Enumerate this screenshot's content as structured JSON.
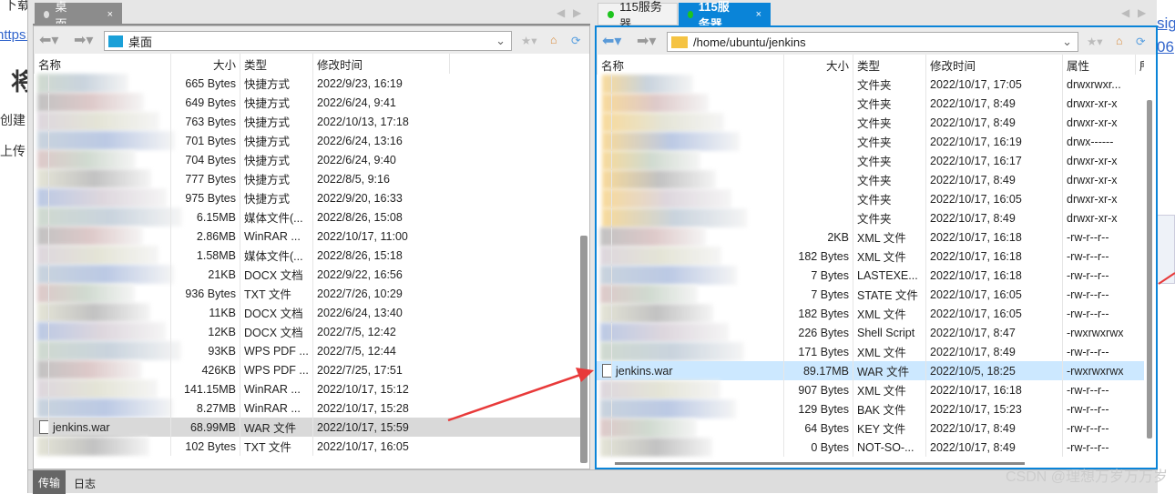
{
  "background": {
    "top_text": "下载",
    "link": "https://",
    "heading": "将",
    "line1": "创建",
    "line2": "上传",
    "right_link1": "sig",
    "right_link2": "06"
  },
  "left": {
    "tab": {
      "label": "桌面",
      "close": "×"
    },
    "path": "桌面",
    "columns": [
      "名称",
      "大小",
      "类型",
      "修改时间"
    ],
    "rows": [
      {
        "name": "",
        "size": "665 Bytes",
        "type": "快捷方式",
        "date": "2022/9/23, 16:19"
      },
      {
        "name": "",
        "size": "649 Bytes",
        "type": "快捷方式",
        "date": "2022/6/24, 9:41"
      },
      {
        "name": "",
        "size": "763 Bytes",
        "type": "快捷方式",
        "date": "2022/10/13, 17:18"
      },
      {
        "name": "",
        "size": "701 Bytes",
        "type": "快捷方式",
        "date": "2022/6/24, 13:16"
      },
      {
        "name": "",
        "size": "704 Bytes",
        "type": "快捷方式",
        "date": "2022/6/24, 9:40"
      },
      {
        "name": "",
        "size": "777 Bytes",
        "type": "快捷方式",
        "date": "2022/8/5, 9:16"
      },
      {
        "name": "",
        "size": "975 Bytes",
        "type": "快捷方式",
        "date": "2022/9/20, 16:33"
      },
      {
        "name": "",
        "size": "6.15MB",
        "type": "媒体文件(...",
        "date": "2022/8/26, 15:08"
      },
      {
        "name": "",
        "size": "2.86MB",
        "type": "WinRAR ...",
        "date": "2022/10/17, 11:00"
      },
      {
        "name": "",
        "size": "1.58MB",
        "type": "媒体文件(...",
        "date": "2022/8/26, 15:18"
      },
      {
        "name": "",
        "size": "21KB",
        "type": "DOCX 文档",
        "date": "2022/9/22, 16:56"
      },
      {
        "name": "",
        "size": "936 Bytes",
        "type": "TXT 文件",
        "date": "2022/7/26, 10:29"
      },
      {
        "name": "",
        "size": "11KB",
        "type": "DOCX 文档",
        "date": "2022/6/24, 13:40"
      },
      {
        "name": "",
        "size": "12KB",
        "type": "DOCX 文档",
        "date": "2022/7/5, 12:42"
      },
      {
        "name": "",
        "size": "93KB",
        "type": "WPS PDF ...",
        "date": "2022/7/5, 12:44"
      },
      {
        "name": "",
        "size": "426KB",
        "type": "WPS PDF ...",
        "date": "2022/7/25, 17:51"
      },
      {
        "name": "",
        "size": "141.15MB",
        "type": "WinRAR ...",
        "date": "2022/10/17, 15:12"
      },
      {
        "name": "",
        "size": "8.27MB",
        "type": "WinRAR ...",
        "date": "2022/10/17, 15:28"
      },
      {
        "name": "jenkins.war",
        "size": "68.99MB",
        "type": "WAR 文件",
        "date": "2022/10/17, 15:59",
        "selected": true
      },
      {
        "name": "",
        "size": "102 Bytes",
        "type": "TXT 文件",
        "date": "2022/10/17, 16:05"
      }
    ]
  },
  "right": {
    "tabs": [
      {
        "label": "115服务器",
        "status_color": "#1ec41e"
      },
      {
        "label": "115服务器",
        "status_color": "#1ec41e",
        "active": true,
        "close": "×"
      }
    ],
    "path": "/home/ubuntu/jenkins",
    "columns": [
      "名称",
      "大小",
      "类型",
      "修改时间",
      "属性",
      "所"
    ],
    "rows": [
      {
        "name": "",
        "size": "",
        "type": "文件夹",
        "date": "2022/10/17, 17:05",
        "attr": "drwxrwxr...",
        "folder": true
      },
      {
        "name": "",
        "size": "",
        "type": "文件夹",
        "date": "2022/10/17, 8:49",
        "attr": "drwxr-xr-x",
        "folder": true
      },
      {
        "name": "",
        "size": "",
        "type": "文件夹",
        "date": "2022/10/17, 8:49",
        "attr": "drwxr-xr-x",
        "folder": true
      },
      {
        "name": "",
        "size": "",
        "type": "文件夹",
        "date": "2022/10/17, 16:19",
        "attr": "drwx------",
        "folder": true
      },
      {
        "name": "",
        "size": "",
        "type": "文件夹",
        "date": "2022/10/17, 16:17",
        "attr": "drwxr-xr-x",
        "folder": true
      },
      {
        "name": "",
        "size": "",
        "type": "文件夹",
        "date": "2022/10/17, 8:49",
        "attr": "drwxr-xr-x",
        "folder": true
      },
      {
        "name": "",
        "size": "",
        "type": "文件夹",
        "date": "2022/10/17, 16:05",
        "attr": "drwxr-xr-x",
        "folder": true
      },
      {
        "name": "",
        "size": "",
        "type": "文件夹",
        "date": "2022/10/17, 8:49",
        "attr": "drwxr-xr-x",
        "folder": true
      },
      {
        "name": "",
        "size": "2KB",
        "type": "XML 文件",
        "date": "2022/10/17, 16:18",
        "attr": "-rw-r--r--"
      },
      {
        "name": "",
        "size": "182 Bytes",
        "type": "XML 文件",
        "date": "2022/10/17, 16:18",
        "attr": "-rw-r--r--"
      },
      {
        "name": "",
        "size": "7 Bytes",
        "type": "LASTEXE...",
        "date": "2022/10/17, 16:18",
        "attr": "-rw-r--r--"
      },
      {
        "name": "",
        "size": "7 Bytes",
        "type": "STATE 文件",
        "date": "2022/10/17, 16:05",
        "attr": "-rw-r--r--"
      },
      {
        "name": "",
        "size": "182 Bytes",
        "type": "XML 文件",
        "date": "2022/10/17, 16:05",
        "attr": "-rw-r--r--"
      },
      {
        "name": "",
        "size": "226 Bytes",
        "type": "Shell Script",
        "date": "2022/10/17, 8:47",
        "attr": "-rwxrwxrwx"
      },
      {
        "name": "",
        "size": "171 Bytes",
        "type": "XML 文件",
        "date": "2022/10/17, 8:49",
        "attr": "-rw-r--r--"
      },
      {
        "name": "jenkins.war",
        "size": "89.17MB",
        "type": "WAR 文件",
        "date": "2022/10/5, 18:25",
        "attr": "-rwxrwxrwx",
        "selected": true
      },
      {
        "name": "",
        "size": "907 Bytes",
        "type": "XML 文件",
        "date": "2022/10/17, 16:18",
        "attr": "-rw-r--r--"
      },
      {
        "name": "",
        "size": "129 Bytes",
        "type": "BAK 文件",
        "date": "2022/10/17, 15:23",
        "attr": "-rw-r--r--"
      },
      {
        "name": "",
        "size": "64 Bytes",
        "type": "KEY 文件",
        "date": "2022/10/17, 8:49",
        "attr": "-rw-r--r--"
      },
      {
        "name": "",
        "size": "0 Bytes",
        "type": "NOT-SO-...",
        "date": "2022/10/17, 8:49",
        "attr": "-rw-r--r--"
      }
    ]
  },
  "statusbar": {
    "tabs": [
      "传输",
      "日志"
    ]
  },
  "watermark": "CSDN @理想万岁万万岁",
  "colors": {
    "accent": "#0a84d8",
    "selected_left": "#d9d9d9",
    "selected_right": "#cce8ff",
    "arrow": "#e83a3a"
  }
}
